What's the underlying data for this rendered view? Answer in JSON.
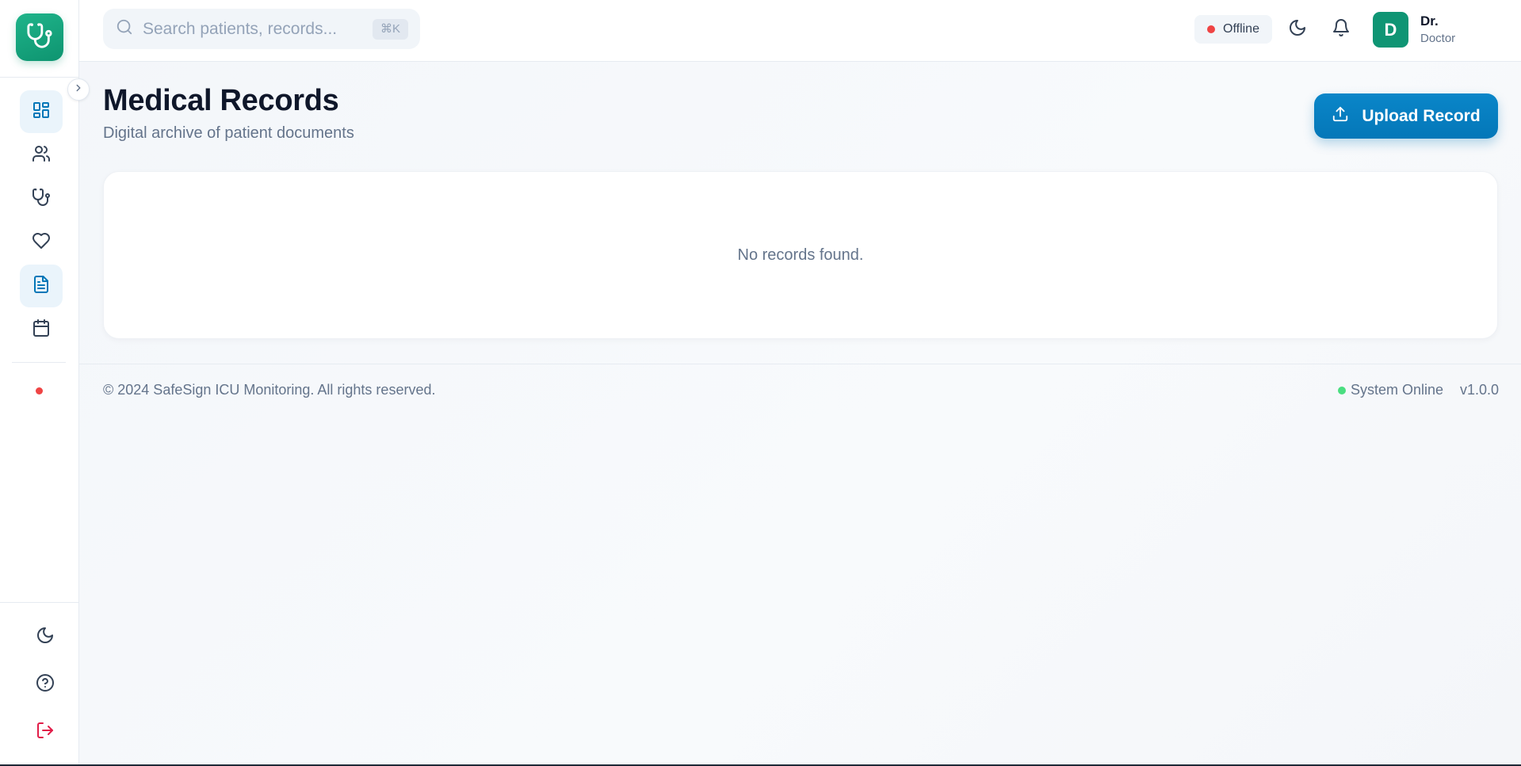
{
  "search": {
    "placeholder": "Search patients, records...",
    "shortcut": "⌘K"
  },
  "header": {
    "status_label": "Offline",
    "user": {
      "initial": "D",
      "name": "Dr.",
      "role": "Doctor"
    }
  },
  "sidebar": {
    "items": [
      {
        "name": "dashboard",
        "icon": "dashboard-icon",
        "active": true
      },
      {
        "name": "patients",
        "icon": "users-icon",
        "active": false
      },
      {
        "name": "doctors",
        "icon": "stethoscope-icon",
        "active": false
      },
      {
        "name": "vitals",
        "icon": "heart-icon",
        "active": false
      },
      {
        "name": "records",
        "icon": "document-icon",
        "active": true
      },
      {
        "name": "schedule",
        "icon": "calendar-icon",
        "active": false
      }
    ],
    "bottom": [
      "moon-icon",
      "help-icon",
      "logout-icon"
    ]
  },
  "main": {
    "title": "Medical Records",
    "subtitle": "Digital archive of patient documents",
    "upload_label": "Upload Record",
    "empty_text": "No records found."
  },
  "footer": {
    "copyright": "© 2024 SafeSign ICU Monitoring. All rights reserved.",
    "system_status": "System Online",
    "version": "v1.0.0"
  },
  "colors": {
    "accent": "#0477b8",
    "brand": "#0f9574",
    "offline": "#ef4444",
    "online": "#4ade80",
    "logout": "#e11d48"
  }
}
